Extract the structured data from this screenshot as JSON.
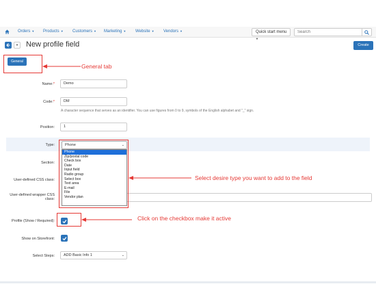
{
  "nav": {
    "items": [
      "Orders",
      "Products",
      "Customers",
      "Marketing",
      "Website",
      "Vendors"
    ],
    "quick_start": "Quick start menu",
    "search_placeholder": "Search"
  },
  "header": {
    "title": "New profile field",
    "create_label": "Create"
  },
  "tabs": {
    "general": "General"
  },
  "form": {
    "name_label": "Name:",
    "name_required": "*",
    "name_value": "Demo",
    "code_label": "Code:",
    "code_required": "*",
    "code_value": "DM",
    "code_hint": "A character sequence that serves as an identifier. You can use figures from 0 to 9, symbols of the English alphabet and \"_\" sign.",
    "position_label": "Position:",
    "position_value": "1",
    "type_label": "Type:",
    "type_value": "Phone",
    "section_label": "Section:",
    "css_class_label": "User-defined CSS class:",
    "wrapper_css_label_1": "User-defined wrapper CSS",
    "wrapper_css_label_2": "class:",
    "profile_label": "Profile (Show / Required):",
    "storefront_label": "Show on Storefront:",
    "steps_label": "Select Steps:",
    "steps_value": "ADD Basic Info 1"
  },
  "type_options": [
    "Phone",
    "Zip/postal code",
    "Check box",
    "Date",
    "Input field",
    "Radio group",
    "Select box",
    "Text area",
    "E-mail",
    "File",
    "Vendor plan"
  ],
  "annotations": {
    "general_tab": "General tab",
    "select_type": "Select desire type you want to add to the field",
    "checkbox": "Click on the checkbox make it active"
  },
  "colors": {
    "accent": "#2b73b9",
    "annotation": "#e53935"
  }
}
